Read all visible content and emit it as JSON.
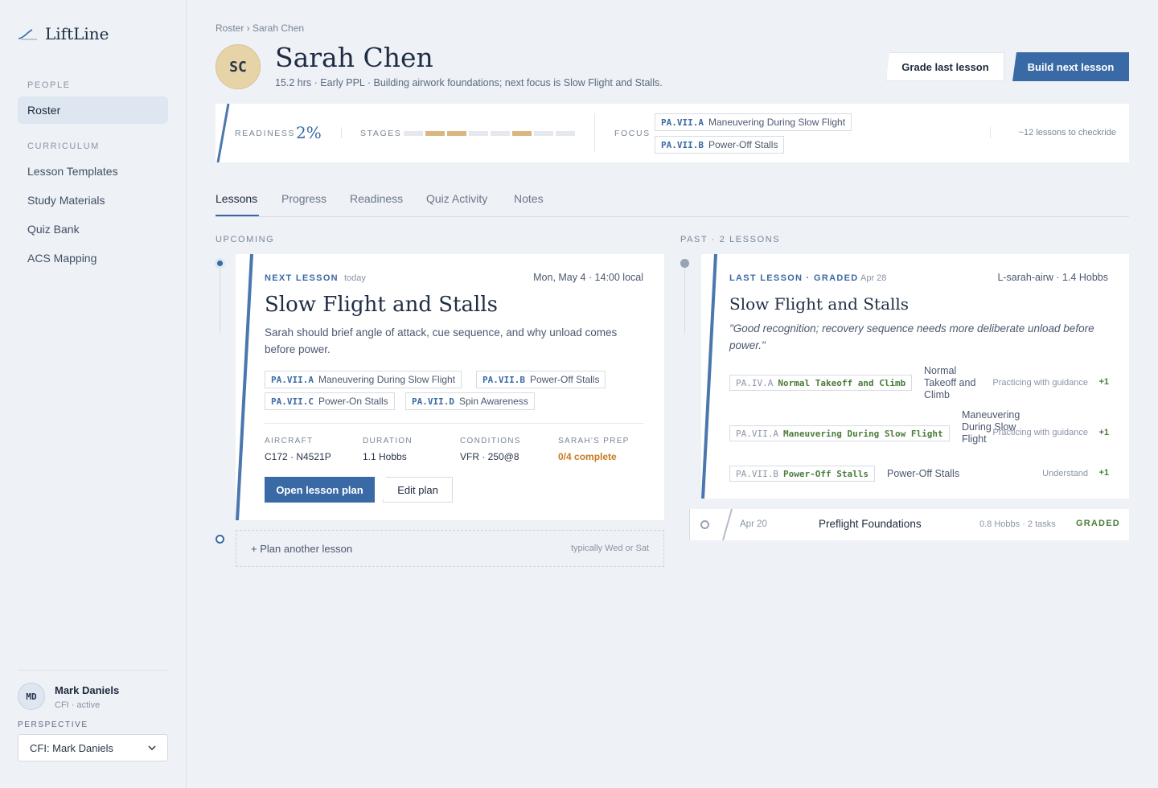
{
  "brand": {
    "name": "LiftLine",
    "logo_icon": "airfoil-line-icon"
  },
  "sidebar": {
    "people_label": "PEOPLE",
    "roster": "Roster",
    "curriculum_label": "CURRICULUM",
    "items": [
      "Lesson Templates",
      "Study Materials",
      "Quiz Bank",
      "ACS Mapping"
    ],
    "user": {
      "initials": "MD",
      "name": "Mark Daniels",
      "sub": "CFI · active"
    },
    "perspective_label": "PERSPECTIVE",
    "perspective_value": "CFI: Mark Daniels"
  },
  "header": {
    "breadcrumb": "Roster › Sarah Chen",
    "initials": "SC",
    "name": "Sarah Chen",
    "subtitle": "15.2 hrs · Early PPL · Building airwork foundations; next focus is Slow Flight and Stalls.",
    "grade_button": "Grade last lesson",
    "build_button": "Build next lesson"
  },
  "status": {
    "readiness_label": "READINESS",
    "readiness_value": "2%",
    "stages_label": "STAGES",
    "stages": [
      false,
      true,
      true,
      false,
      false,
      true,
      false,
      false
    ],
    "focus_label": "FOCUS",
    "focus": [
      {
        "code": "PA.VII.A",
        "name": "Maneuvering During Slow Flight"
      },
      {
        "code": "PA.VII.B",
        "name": "Power-Off Stalls"
      }
    ],
    "checkride": "~12 lessons to checkride"
  },
  "tabs": [
    "Lessons",
    "Progress",
    "Readiness",
    "Quiz Activity",
    "Notes"
  ],
  "upcoming": {
    "label": "UPCOMING",
    "next": {
      "eyebrow": "NEXT LESSON",
      "when": "today",
      "datetime": "Mon, May 4 · 14:00 local",
      "title": "Slow Flight and Stalls",
      "desc": "Sarah should brief angle of attack, cue sequence, and why unload comes before power.",
      "tasks": [
        {
          "code": "PA.VII.A",
          "name": "Maneuvering During Slow Flight"
        },
        {
          "code": "PA.VII.B",
          "name": "Power-Off Stalls"
        },
        {
          "code": "PA.VII.C",
          "name": "Power-On Stalls"
        },
        {
          "code": "PA.VII.D",
          "name": "Spin Awareness"
        }
      ],
      "meta": [
        {
          "label": "AIRCRAFT",
          "value": "C172 · N4521P"
        },
        {
          "label": "DURATION",
          "value": "1.1 Hobbs"
        },
        {
          "label": "CONDITIONS",
          "value": "VFR · 250@8"
        },
        {
          "label": "SARAH'S PREP",
          "value": "0/4 complete"
        }
      ],
      "open_button": "Open lesson plan",
      "edit_button": "Edit plan"
    },
    "plan_another": "+ Plan another lesson",
    "plan_hint": "typically Wed or Sat"
  },
  "past": {
    "label": "PAST · 2 LESSONS",
    "last": {
      "eyebrow": "LAST LESSON · GRADED",
      "date": "Apr 28",
      "meta": "L-sarah-airw · 1.4 Hobbs",
      "title": "Slow Flight and Stalls",
      "quote": "\"Good recognition; recovery sequence needs more deliberate unload before power.\"",
      "grades": [
        {
          "code": "PA.IV.A",
          "name": "Normal Takeoff and Climb",
          "desc": "Normal Takeoff and Climb",
          "status": "Practicing with guidance",
          "delta": "+1"
        },
        {
          "code": "PA.VII.A",
          "name": "Maneuvering During Slow Flight",
          "desc": "Maneuvering During Slow Flight",
          "status": "Practicing with guidance",
          "delta": "+1"
        },
        {
          "code": "PA.VII.B",
          "name": "Power-Off Stalls",
          "desc": "Power-Off Stalls",
          "status": "Understand",
          "delta": "+1"
        }
      ]
    },
    "older": {
      "date": "Apr 20",
      "title": "Preflight Foundations",
      "meta": "0.8 Hobbs · 2 tasks",
      "status": "GRADED"
    }
  }
}
